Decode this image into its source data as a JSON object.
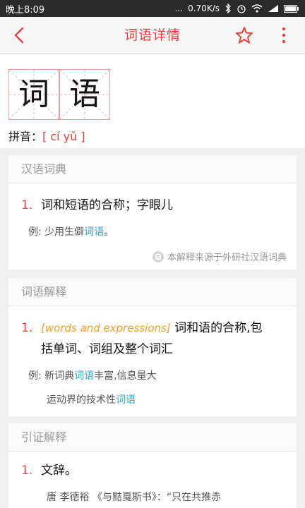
{
  "status": {
    "time": "晚上8:09",
    "dots": "...",
    "speed": "0.70K/s"
  },
  "header": {
    "title": "词语详情"
  },
  "word": {
    "chars": [
      "词",
      "语"
    ],
    "pinyin_label": "拼音：",
    "pinyin": "[ cí yǔ ]"
  },
  "cards": {
    "hanyu": {
      "title": "汉语词典",
      "num": "1.",
      "definition": "词和短语的合称；字眼儿",
      "example_prefix": "例: 少用生僻",
      "example_hl": "词语",
      "example_suffix": "。",
      "source": "本解释来源于外研社汉语词典"
    },
    "jieshi": {
      "title": "词语解释",
      "num": "1.",
      "en_tag": "[words and expressions]",
      "def_line1": " 词和语的合称,包",
      "def_line2": "括单词、词组及整个词汇",
      "ex1_prefix": "例: 新词典",
      "ex1_hl": "词语",
      "ex1_suffix": "丰富,信息量大",
      "ex2_prefix": "运动界的技术性",
      "ex2_hl": "词语"
    },
    "yinzheng": {
      "title": "引证解释",
      "num": "1.",
      "definition": "文辞。",
      "quote": "唐 李德裕 《与黠戛斯书》：“只在共推赤"
    }
  },
  "colors": {
    "accent": "#e8403f",
    "link": "#29a7c9",
    "en_tag": "#f0a020"
  }
}
